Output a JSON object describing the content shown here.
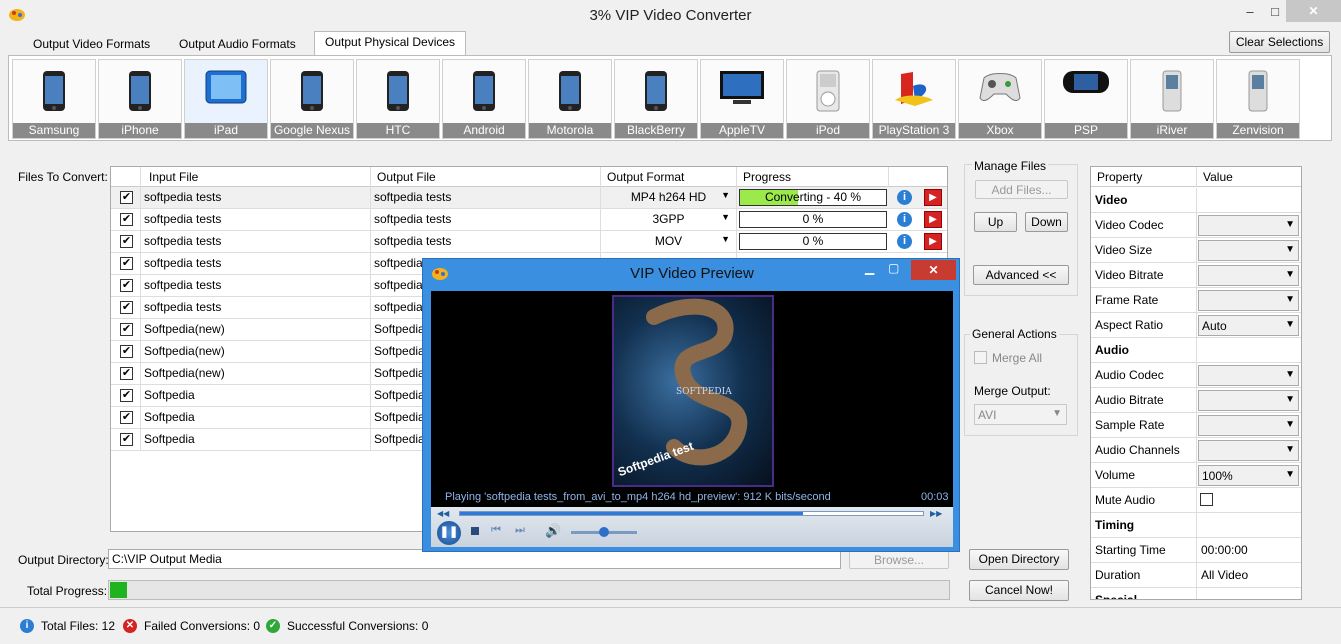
{
  "window": {
    "title": "3% VIP Video Converter",
    "minimize": "–",
    "maximize": "□",
    "close": "✕"
  },
  "tabs": [
    {
      "label": "Output Video Formats"
    },
    {
      "label": "Output Audio Formats"
    },
    {
      "label": "Output Physical Devices"
    }
  ],
  "clear_selections": "Clear Selections",
  "devices": [
    {
      "label": "Samsung",
      "icon": "phone-icon"
    },
    {
      "label": "iPhone",
      "icon": "phone-icon"
    },
    {
      "label": "iPad",
      "icon": "tablet-icon"
    },
    {
      "label": "Google Nexus",
      "icon": "phone-icon"
    },
    {
      "label": "HTC",
      "icon": "phone-icon"
    },
    {
      "label": "Android",
      "icon": "phone-icon"
    },
    {
      "label": "Motorola",
      "icon": "phone-icon"
    },
    {
      "label": "BlackBerry",
      "icon": "phone-icon"
    },
    {
      "label": "AppleTV",
      "icon": "tv-icon"
    },
    {
      "label": "iPod",
      "icon": "ipod-icon"
    },
    {
      "label": "PlayStation 3",
      "icon": "playstation-icon"
    },
    {
      "label": "Xbox",
      "icon": "gamepad-icon"
    },
    {
      "label": "PSP",
      "icon": "psp-icon"
    },
    {
      "label": "iRiver",
      "icon": "player-icon"
    },
    {
      "label": "Zenvision",
      "icon": "player-icon"
    }
  ],
  "files_label": "Files To Convert:",
  "grid": {
    "headers": {
      "input": "Input File",
      "output": "Output File",
      "format": "Output Format",
      "progress": "Progress"
    },
    "rows": [
      {
        "input": "softpedia tests",
        "output": "softpedia tests",
        "format": "MP4 h264 HD",
        "progress": "Converting - 40 %",
        "fill": 0.4
      },
      {
        "input": "softpedia tests",
        "output": "softpedia tests",
        "format": "3GPP",
        "progress": "0 %",
        "fill": 0
      },
      {
        "input": "softpedia tests",
        "output": "softpedia tests",
        "format": "MOV",
        "progress": "0 %",
        "fill": 0
      },
      {
        "input": "softpedia tests",
        "output": "softpedia t",
        "format": "",
        "progress": "",
        "fill": 0
      },
      {
        "input": "softpedia tests",
        "output": "softpedia t",
        "format": "",
        "progress": "",
        "fill": 0
      },
      {
        "input": "softpedia tests",
        "output": "softpedia t",
        "format": "",
        "progress": "",
        "fill": 0
      },
      {
        "input": "Softpedia(new)",
        "output": "Softpedia(",
        "format": "",
        "progress": "",
        "fill": 0
      },
      {
        "input": "Softpedia(new)",
        "output": "Softpedia(",
        "format": "",
        "progress": "",
        "fill": 0
      },
      {
        "input": "Softpedia(new)",
        "output": "Softpedia(",
        "format": "",
        "progress": "",
        "fill": 0
      },
      {
        "input": "Softpedia",
        "output": "Softpedia",
        "format": "",
        "progress": "",
        "fill": 0
      },
      {
        "input": "Softpedia",
        "output": "Softpedia",
        "format": "",
        "progress": "",
        "fill": 0
      },
      {
        "input": "Softpedia",
        "output": "Softpedia",
        "format": "",
        "progress": "",
        "fill": 0
      }
    ]
  },
  "manage": {
    "title": "Manage Files",
    "add": "Add Files...",
    "up": "Up",
    "down": "Down",
    "advanced": "Advanced  <<"
  },
  "general": {
    "title": "General Actions",
    "merge_all": "Merge All",
    "merge_output": "Merge Output:",
    "merge_value": "AVI"
  },
  "props": {
    "headers": {
      "property": "Property",
      "value": "Value"
    },
    "rows": [
      {
        "name": "Video",
        "type": "section",
        "value": ""
      },
      {
        "name": "Video Codec",
        "type": "drop",
        "value": ""
      },
      {
        "name": "Video Size",
        "type": "drop",
        "value": ""
      },
      {
        "name": "Video Bitrate",
        "type": "drop",
        "value": ""
      },
      {
        "name": "Frame Rate",
        "type": "drop",
        "value": ""
      },
      {
        "name": "Aspect Ratio",
        "type": "drop",
        "value": "Auto"
      },
      {
        "name": "Audio",
        "type": "section",
        "value": ""
      },
      {
        "name": "Audio Codec",
        "type": "drop",
        "value": ""
      },
      {
        "name": "Audio Bitrate",
        "type": "drop",
        "value": ""
      },
      {
        "name": "Sample Rate",
        "type": "drop",
        "value": ""
      },
      {
        "name": "Audio Channels",
        "type": "drop",
        "value": ""
      },
      {
        "name": "Volume",
        "type": "drop",
        "value": "100%"
      },
      {
        "name": "Mute Audio",
        "type": "check",
        "value": ""
      },
      {
        "name": "Timing",
        "type": "section",
        "value": ""
      },
      {
        "name": "Starting Time",
        "type": "text",
        "value": "00:00:00"
      },
      {
        "name": "Duration",
        "type": "text",
        "value": "All Video"
      },
      {
        "name": "Special",
        "type": "section",
        "value": ""
      }
    ]
  },
  "output_dir": {
    "label": "Output Directory:",
    "value": "C:\\VIP Output Media",
    "browse": "Browse...",
    "open": "Open Directory"
  },
  "total": {
    "label": "Total Progress:",
    "cancel": "Cancel Now!",
    "fill": 0.02
  },
  "preview": {
    "title": "VIP Video Preview",
    "poster_brand": "SOFTPEDIA",
    "poster_text": "Softpedia test",
    "status": "Playing 'softpedia tests_from_avi_to_mp4 h264 hd_preview': 912 K bits/second",
    "time": "00:03",
    "seek": 0.74,
    "volume": 0.5
  },
  "statusbar": {
    "total_files": "Total Files: 12",
    "failed": "Failed Conversions: 0",
    "success": "Successful Conversions: 0"
  },
  "colors": {
    "progress": "#9be94a",
    "accent": "#3b8fe0",
    "danger": "#d42323"
  }
}
